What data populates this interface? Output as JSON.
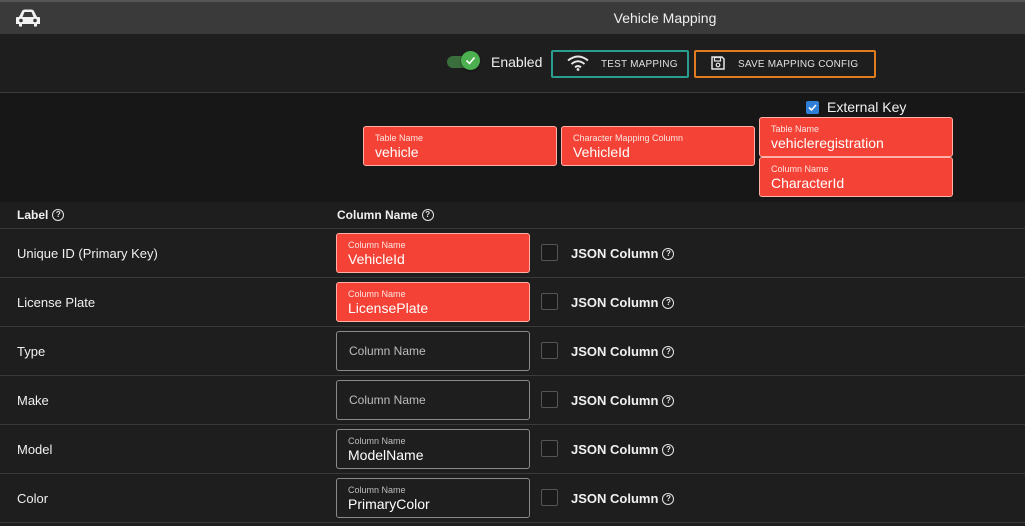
{
  "window": {
    "title": "Vehicle Mapping",
    "logo_icon": "car-icon"
  },
  "toolbar": {
    "enabled_label": "Enabled",
    "enabled": true,
    "test_label": "TEST MAPPING",
    "save_label": "SAVE MAPPING CONFIG",
    "colors": {
      "test_border": "#2a9d8f",
      "save_border": "#e07b1f",
      "toggle": "#4caf50"
    }
  },
  "mapping": {
    "table_name": {
      "label": "Table Name",
      "value": "vehicle"
    },
    "character_column": {
      "label": "Character Mapping Column",
      "value": "VehicleId"
    },
    "external_key": {
      "label": "External Key",
      "checked": true
    },
    "ext_table": {
      "label": "Table Name",
      "value": "vehicleregistration"
    },
    "ext_column": {
      "label": "Column Name",
      "value": "CharacterId"
    }
  },
  "grid": {
    "headers": {
      "label": "Label",
      "column": "Column Name"
    },
    "json_label": "JSON Column",
    "rows": [
      {
        "label": "Unique ID (Primary Key)",
        "field_label": "Column Name",
        "value": "VehicleId",
        "state": "error"
      },
      {
        "label": "License Plate",
        "field_label": "Column Name",
        "value": "LicensePlate",
        "state": "error"
      },
      {
        "label": "Type",
        "placeholder": "Column Name",
        "value": "",
        "state": "empty"
      },
      {
        "label": "Make",
        "placeholder": "Column Name",
        "value": "",
        "state": "empty"
      },
      {
        "label": "Model",
        "field_label": "Column Name",
        "value": "ModelName",
        "state": "filled"
      },
      {
        "label": "Color",
        "field_label": "Column Name",
        "value": "PrimaryColor",
        "state": "filled"
      }
    ]
  },
  "colors": {
    "error": "#f44336",
    "accent_blue": "#2f7fd6"
  }
}
